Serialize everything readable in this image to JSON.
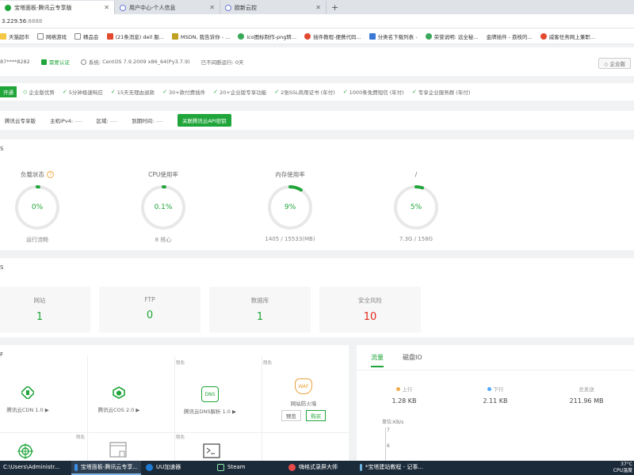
{
  "browser": {
    "tabs": [
      {
        "label": "宝塔面板-腾讯云专享版",
        "active": true
      },
      {
        "label": "用户中心-个人信息",
        "active": false
      },
      {
        "label": "欧新云控",
        "active": false
      }
    ],
    "new_tab": "+",
    "url_host": "3.229.56",
    "url_port": ":8888",
    "bookmarks": [
      "天猫超市",
      "网络游戏",
      "精品会",
      "(21条消息) dell 服...",
      "MSDN, 我告诉你 - ...",
      "ico图标制作-png转...",
      "插件教程-便携代码...",
      "分类名下载列表 -",
      "荣誉说明: 远全秘...",
      "金牌插件 - 荔枝的...",
      "威客任务网上兼职..."
    ]
  },
  "header": {
    "account": "87****8282",
    "account_badge": "需要认证",
    "system_label": "系统:",
    "system": "CentOS 7.9.2009 x86_64(Py3.7.9)",
    "uptime": "已不间断运行: 0天",
    "store_button": "企业版"
  },
  "features": {
    "open_badge": "开通",
    "items": [
      "企业版优势",
      "5分钟极速响应",
      "15天无理由退款",
      "30+款付费插件",
      "20+企业版专享功能",
      "2张SSL商用证书 (年付)",
      "1000条免费短信 (年付)",
      "专享企业服务群 (年付)"
    ]
  },
  "tencent": {
    "title": "腾讯云专享版",
    "ip_label": "主机IPv4:",
    "ip_value": "----",
    "region_label": "区域:",
    "region_value": "----",
    "expire_label": "到期时间:",
    "expire_value": "----",
    "bind_button": "关联腾讯云API密钥"
  },
  "status": {
    "title_stub": "S",
    "gauges": [
      {
        "title": "负载状态",
        "value": "0%",
        "sub": "运行流畅",
        "percent": 0,
        "help": "?"
      },
      {
        "title": "CPU使用率",
        "value": "0.1%",
        "sub": "8 核心",
        "percent": 0.1
      },
      {
        "title": "内存使用率",
        "value": "9%",
        "sub": "1405 / 15533(MB)",
        "percent": 9
      },
      {
        "title": "/",
        "value": "5%",
        "sub": "7.3G / 158G",
        "percent": 5
      }
    ],
    "accent_color": "#20a53a",
    "track_color": "#e8e8e8"
  },
  "overview": {
    "title_stub": "S",
    "cards": [
      {
        "label": "网站",
        "value": "1",
        "danger": false
      },
      {
        "label": "FTP",
        "value": "0",
        "danger": false
      },
      {
        "label": "数据库",
        "value": "1",
        "danger": false
      },
      {
        "label": "安全风险",
        "value": "10",
        "danger": true
      }
    ]
  },
  "software": {
    "title_stub": "F",
    "items": [
      {
        "name": "腾讯云CDN 1.0 ▶",
        "icon": "cdn-icon"
      },
      {
        "name": "腾讯云COS 2.0 ▶",
        "icon": "cos-icon"
      },
      {
        "name": "腾讯云DNS解析 1.0 ▶",
        "icon": "dns-icon",
        "icon_text": "DNS"
      },
      {
        "name": "网站防火墙",
        "icon": "waf-icon",
        "icon_text": "WAF",
        "preview": "预览",
        "buy": "购买"
      }
    ],
    "tag_trial": "限免"
  },
  "traffic": {
    "tabs": [
      "流量",
      "磁盘IO"
    ],
    "up_label": "上行",
    "up_value": "1.28 KB",
    "up_color": "#f0ad4e",
    "down_label": "下行",
    "down_value": "2.11 KB",
    "down_color": "#52a9ff",
    "total_label": "总发送",
    "total_value": "211.96 MB",
    "unit_label": "单位:KB/s",
    "ticks": [
      "7",
      "6"
    ]
  },
  "taskbar": {
    "items": [
      "C:\\Users\\Administr...",
      "宝塔面板-腾讯云专享...",
      "UU加速器",
      "Steam",
      "嗨格式录屏大师",
      "*宝塔建站教程 - 记事..."
    ],
    "temp": "37°C",
    "cpu": "CPU温度"
  }
}
